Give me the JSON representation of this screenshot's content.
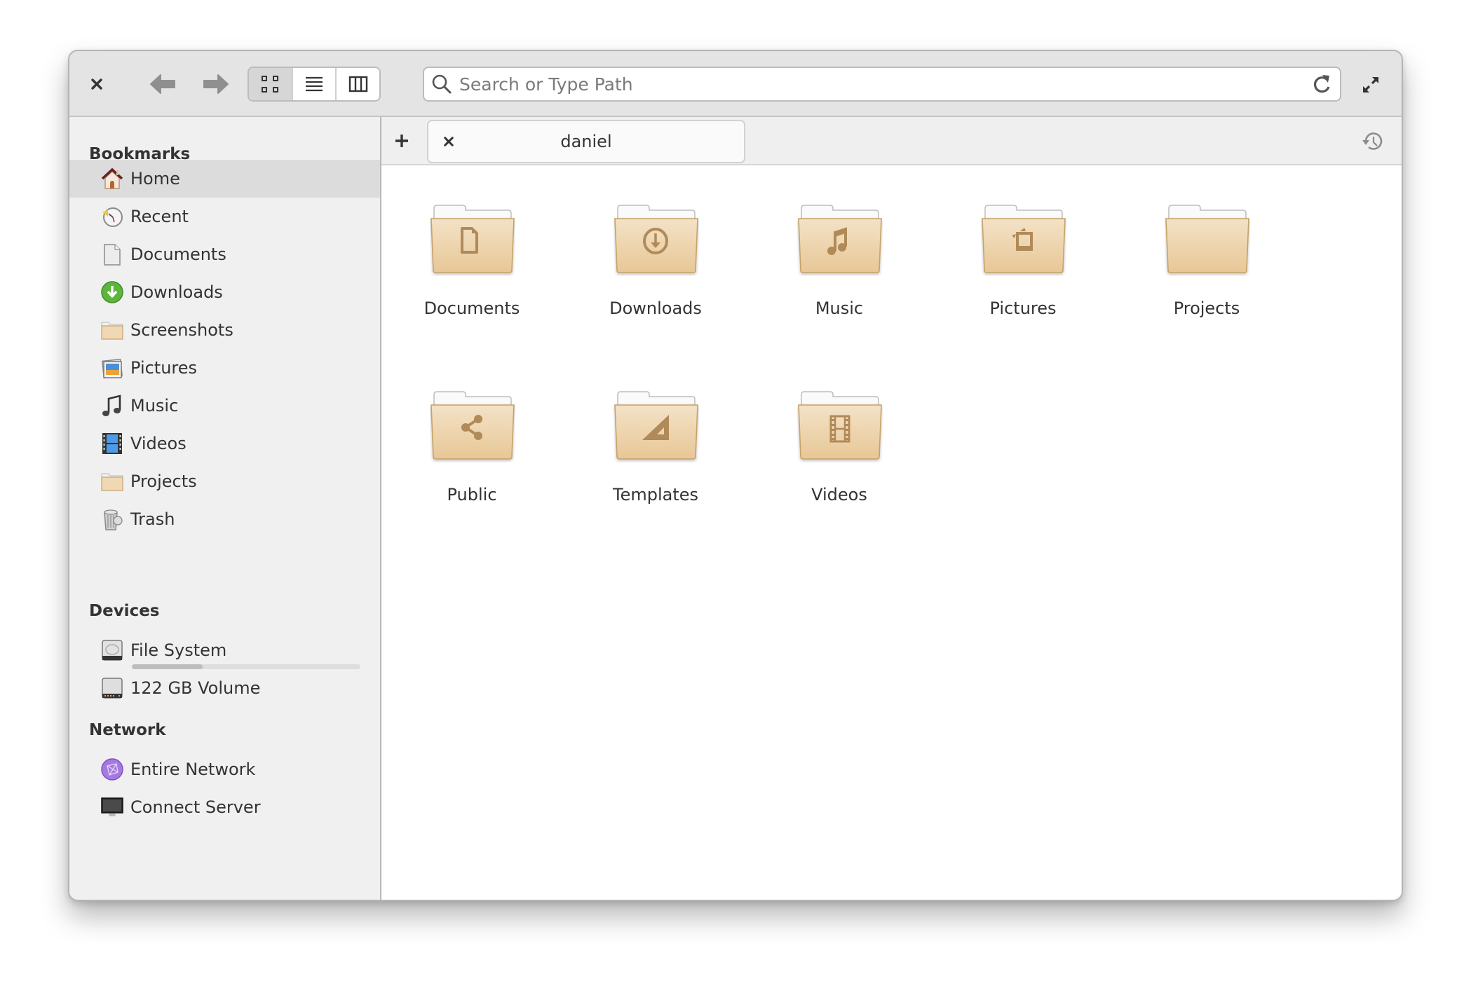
{
  "header": {
    "close_label": "Close window",
    "back_label": "Back",
    "forward_label": "Forward",
    "view_modes": [
      {
        "name": "grid",
        "label": "Icon view",
        "active": true
      },
      {
        "name": "list",
        "label": "List view",
        "active": false
      },
      {
        "name": "columns",
        "label": "Column view",
        "active": false
      }
    ],
    "search": {
      "placeholder": "Search or Type Path",
      "value": ""
    },
    "reload_label": "Reload",
    "fullscreen_label": "Fullscreen"
  },
  "sidebar": {
    "sections": [
      {
        "title": "Bookmarks",
        "items": [
          {
            "label": "Home",
            "icon": "home-icon",
            "active": true
          },
          {
            "label": "Recent",
            "icon": "recent-icon"
          },
          {
            "label": "Documents",
            "icon": "document-icon"
          },
          {
            "label": "Downloads",
            "icon": "download-icon"
          },
          {
            "label": "Screenshots",
            "icon": "folder-icon"
          },
          {
            "label": "Pictures",
            "icon": "pictures-icon"
          },
          {
            "label": "Music",
            "icon": "music-icon"
          },
          {
            "label": "Videos",
            "icon": "videos-icon"
          },
          {
            "label": "Projects",
            "icon": "folder-icon"
          },
          {
            "label": "Trash",
            "icon": "trash-icon"
          }
        ]
      },
      {
        "title": "Devices",
        "items": [
          {
            "label": "File System",
            "icon": "hard-drive-icon",
            "usage_percent": 31
          },
          {
            "label": "122 GB Volume",
            "icon": "drive-icon"
          }
        ]
      },
      {
        "title": "Network",
        "items": [
          {
            "label": "Entire Network",
            "icon": "network-icon"
          },
          {
            "label": "Connect Server",
            "icon": "server-icon"
          }
        ]
      }
    ]
  },
  "tabs": {
    "new_tab_label": "New tab",
    "history_label": "Closed tabs",
    "items": [
      {
        "label": "daniel"
      }
    ]
  },
  "content": {
    "items": [
      {
        "label": "Documents",
        "glyph": "document"
      },
      {
        "label": "Downloads",
        "glyph": "download"
      },
      {
        "label": "Music",
        "glyph": "music"
      },
      {
        "label": "Pictures",
        "glyph": "pictures"
      },
      {
        "label": "Projects",
        "glyph": "none"
      },
      {
        "label": "Public",
        "glyph": "share"
      },
      {
        "label": "Templates",
        "glyph": "templates"
      },
      {
        "label": "Videos",
        "glyph": "video"
      }
    ]
  },
  "colors": {
    "folder_front_top": "#f3e2c6",
    "folder_front_bottom": "#e8c796",
    "folder_border": "#c6a26a",
    "folder_glyph": "#b08a58",
    "sidebar_bg": "#f0f0f0",
    "sidebar_active": "#dcdcdc",
    "header_bg": "#e4e4e4"
  }
}
